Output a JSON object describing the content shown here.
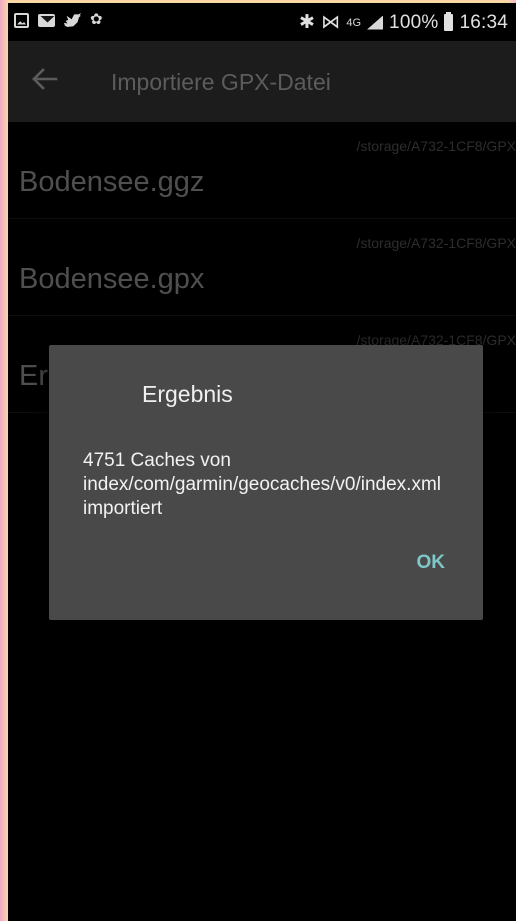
{
  "status_bar": {
    "battery": "100%",
    "time": "16:34",
    "network": "4G"
  },
  "app_bar": {
    "title": "Importiere GPX-Datei"
  },
  "files": [
    {
      "path": "/storage/A732-1CF8/GPX",
      "name": "Bodensee.ggz"
    },
    {
      "path": "/storage/A732-1CF8/GPX",
      "name": "Bodensee.gpx"
    },
    {
      "path": "/storage/A732-1CF8/GPX",
      "name": "Er"
    }
  ],
  "dialog": {
    "title": "Ergebnis",
    "message": "4751 Caches von index/com/garmin/geocaches/v0/index.xml importiert",
    "ok_label": "OK"
  },
  "colors": {
    "accent": "#7fc7c7",
    "background": "#000000",
    "app_bar": "#1c1c1c",
    "dialog": "#494949"
  }
}
